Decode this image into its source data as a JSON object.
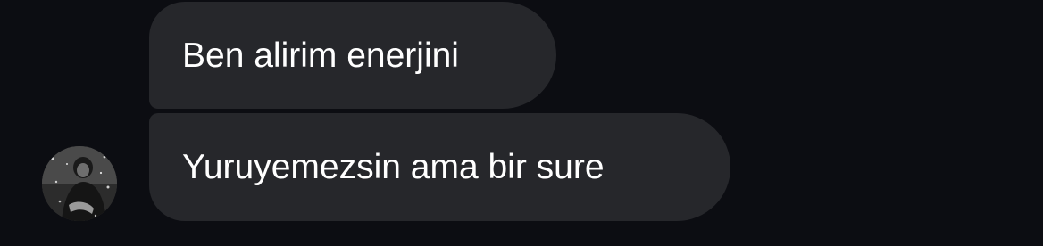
{
  "messages": [
    {
      "text": "Ben alirim enerjini"
    },
    {
      "text": "Yuruyemezsin ama bir sure"
    }
  ],
  "sender": {
    "avatar_icon": "user-photo-avatar"
  },
  "colors": {
    "background": "#0c0d12",
    "bubble": "#26272b",
    "text": "#ffffff"
  }
}
